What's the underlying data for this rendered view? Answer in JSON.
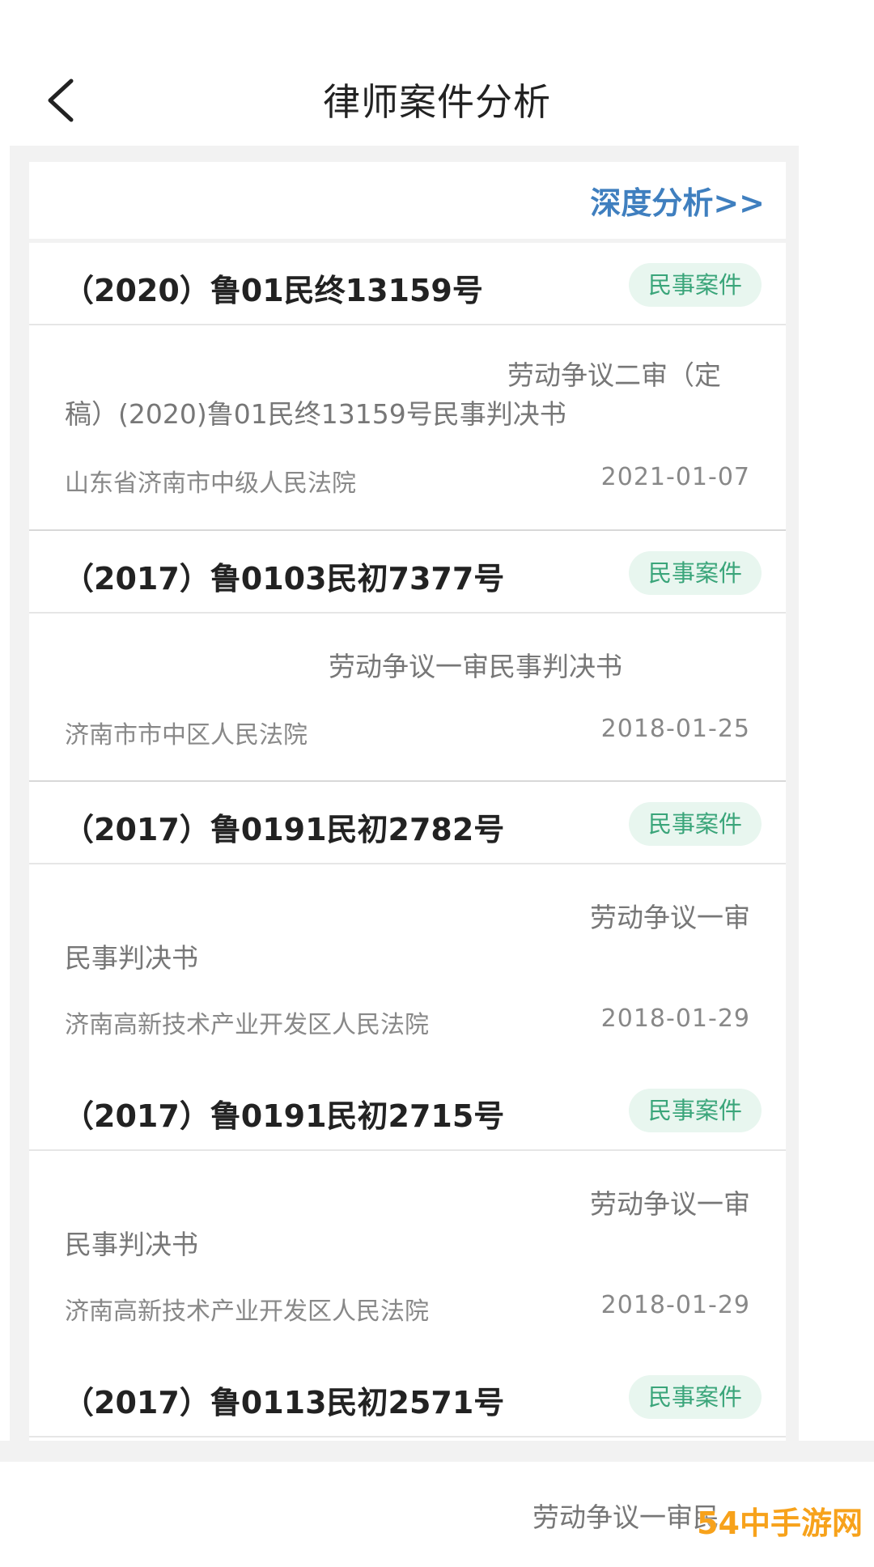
{
  "header": {
    "title": "律师案件分析"
  },
  "deep_analysis": "深度分析>>",
  "cases": [
    {
      "case_no": "（2020）鲁01民终13159号",
      "tag": "民事案件",
      "title_line1": "劳动争议二审（定",
      "title_line2": "稿）(2020)鲁01民终13159号民事判决书",
      "court": "山东省济南市中级人民法院",
      "date": "2021-01-07"
    },
    {
      "case_no": "（2017）鲁0103民初7377号",
      "tag": "民事案件",
      "title_line1": "劳动争议一审民事判决书",
      "title_line2": "",
      "court": "济南市市中区人民法院",
      "date": "2018-01-25"
    },
    {
      "case_no": "（2017）鲁0191民初2782号",
      "tag": "民事案件",
      "title_line1": "劳动争议一审",
      "title_line2": "民事判决书",
      "court": "济南高新技术产业开发区人民法院",
      "date": "2018-01-29"
    },
    {
      "case_no": "（2017）鲁0191民初2715号",
      "tag": "民事案件",
      "title_line1": "劳动争议一审",
      "title_line2": "民事判决书",
      "court": "济南高新技术产业开发区人民法院",
      "date": "2018-01-29"
    },
    {
      "case_no": "（2017）鲁0113民初2571号",
      "tag": "民事案件",
      "title_line1": "劳动争议一审民",
      "title_line2": "",
      "court": "",
      "date": ""
    }
  ],
  "watermark": "54中手游网"
}
